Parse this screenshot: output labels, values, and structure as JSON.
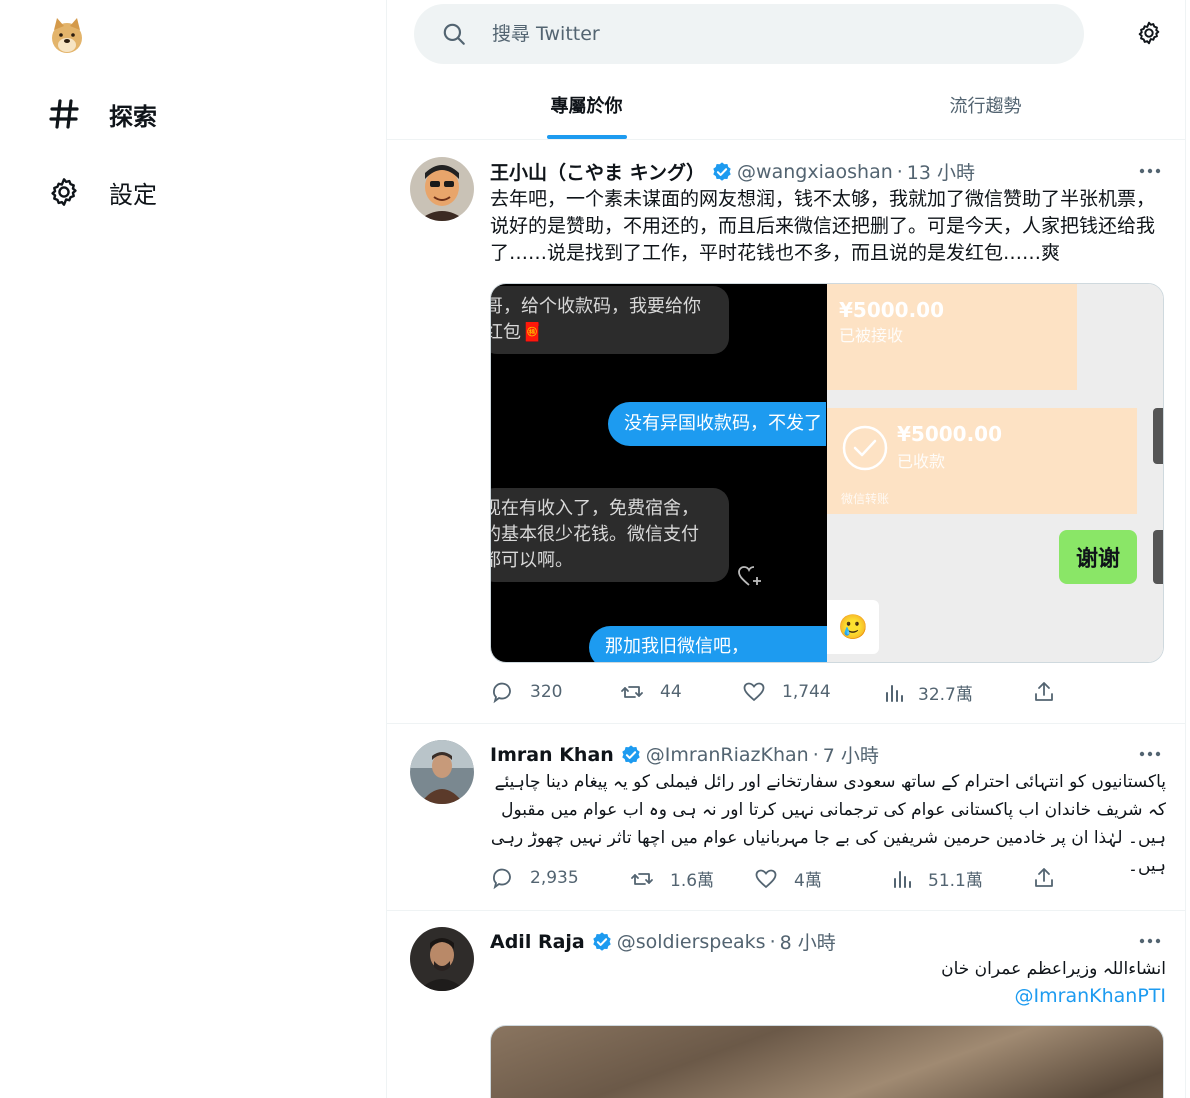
{
  "nav": {
    "items": [
      {
        "label": "探索",
        "icon": "hashtag-icon"
      },
      {
        "label": "設定",
        "icon": "gear-icon"
      }
    ]
  },
  "search": {
    "placeholder": "搜尋 Twitter"
  },
  "tabs": [
    {
      "label": "專屬於你",
      "active": true
    },
    {
      "label": "流行趨勢",
      "active": false
    }
  ],
  "tweets": [
    {
      "name": "王小山（こやま キング）",
      "handle": "@wangxiaoshan",
      "time": "13 小時",
      "text": "去年吧，一个素未谋面的网友想润，钱不太够，我就加了微信赞助了半张机票，说好的是赞助，不用还的，而且后来微信还把删了。可是今天，人家把钱还给我了……说是找到了工作，平时花钱也不多，而且说的是发红包……爽",
      "media": {
        "left": {
          "bubble1": "哥，给个收款码，我要给你红包🧧",
          "bubble2": "没有异国收款码，不发了",
          "bubble3": "现在有收入了，免费宿舍，的基本很少花钱。微信支付都可以啊。",
          "bubble4": "那加我旧微信吧，"
        },
        "right": {
          "card1_amount": "¥5000.00",
          "card1_status": "已被接收",
          "card2_amount": "¥5000.00",
          "card2_status": "已收款",
          "card2_footer": "微信转账",
          "thanks": "谢谢",
          "emoji": "🥲"
        }
      },
      "stats": {
        "replies": "320",
        "retweets": "44",
        "likes": "1,744",
        "views": "32.7萬"
      }
    },
    {
      "name": "Imran Khan",
      "handle": "@ImranRiazKhan",
      "time": "7 小時",
      "text": "پاکستانیوں کو انتہائی احترام کے ساتھ سعودی سفارتخانے اور رائل فیملی کو یہ پیغام دینا چاہیئے کہ شریف خاندان اب پاکستانی عوام کی ترجمانی نہیں کرتا اور نہ ہی وہ اب عوام میں مقبول ہیں۔ لہٰذا ان پر خادمین حرمین شریفین کی بے جا مہربانیاں عوام میں اچھا تاثر نہیں چھوڑ رہی ہیں۔",
      "stats": {
        "replies": "2,935",
        "retweets": "1.6萬",
        "likes": "4萬",
        "views": "51.1萬"
      }
    },
    {
      "name": "Adil Raja",
      "handle": "@soldierspeaks",
      "time": "8 小時",
      "text": "انشاءاللہ وزیراعظم عمران خان",
      "mention": "@ImranKhanPTI"
    }
  ],
  "colors": {
    "accent": "#1d9bf0",
    "text": "#0f1419",
    "muted": "#536471",
    "search_bg": "#eff3f4"
  }
}
